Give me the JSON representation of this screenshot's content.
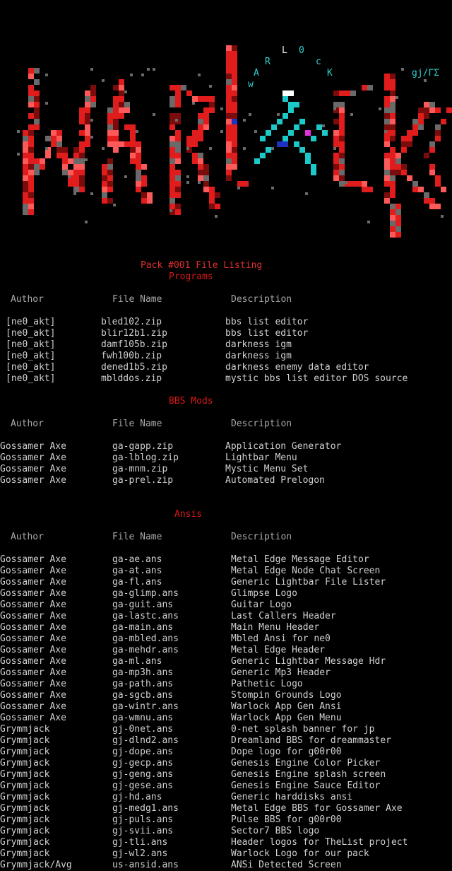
{
  "logo": {
    "letters": [
      "L",
      "0",
      "R",
      "c",
      "A",
      "K",
      "w"
    ],
    "tag": "gj/ΓΣ",
    "colors": {
      "red": "#e01c1c",
      "pink": "#ff5a5a",
      "dark": "#7a0c0c",
      "gray": "#6a6a6a",
      "cyan": "#1cc8c8",
      "blue": "#2030c0",
      "magenta": "#e030e0"
    }
  },
  "title": "Pack #001 File Listing",
  "columns": {
    "author": "Author",
    "file": "File Name",
    "desc": "Description"
  },
  "sections": [
    {
      "name": "Programs",
      "rows": [
        [
          "[ne0_akt]",
          "bled102.zip",
          "bbs list editor"
        ],
        [
          "[ne0_akt]",
          "blir12b1.zip",
          "bbs list editor"
        ],
        [
          "[ne0_akt]",
          "damf105b.zip",
          "darkness igm"
        ],
        [
          "[ne0_akt]",
          "fwh100b.zip",
          "darkness igm"
        ],
        [
          "[ne0_akt]",
          "dened1b5.zip",
          "darkness enemy data editor"
        ],
        [
          "[ne0_akt]",
          "mblddos.zip",
          "mystic bbs list editor DOS source"
        ]
      ]
    },
    {
      "name": "BBS Mods",
      "rows": [
        [
          "Gossamer Axe",
          "ga-gapp.zip",
          "Application Generator"
        ],
        [
          "Gossamer Axe",
          "ga-lblog.zip",
          "Lightbar Menu"
        ],
        [
          "Gossamer Axe",
          "ga-mnm.zip",
          "Mystic Menu Set"
        ],
        [
          "Gossamer Axe",
          "ga-prel.zip",
          "Automated Prelogon"
        ]
      ]
    },
    {
      "name": "Ansis",
      "rows": [
        [
          "Gossamer Axe",
          "ga-ae.ans",
          "Metal Edge Message Editor"
        ],
        [
          "Gossamer Axe",
          "ga-at.ans",
          "Metal Edge Node Chat Screen"
        ],
        [
          "Gossamer Axe",
          "ga-fl.ans",
          "Generic Lightbar File Lister"
        ],
        [
          "Gossamer Axe",
          "ga-glimp.ans",
          "Glimpse Logo"
        ],
        [
          "Gossamer Axe",
          "ga-guit.ans",
          "Guitar Logo"
        ],
        [
          "Gossamer Axe",
          "ga-lastc.ans",
          "Last Callers Header"
        ],
        [
          "Gossamer Axe",
          "ga-main.ans",
          "Main Menu Header"
        ],
        [
          "Gossamer Axe",
          "ga-mbled.ans",
          "Mbled Ansi for ne0"
        ],
        [
          "Gossamer Axe",
          "ga-mehdr.ans",
          "Metal Edge Header"
        ],
        [
          "Gossamer Axe",
          "ga-ml.ans",
          "Generic Lightbar Message Hdr"
        ],
        [
          "Gossamer Axe",
          "ga-mp3h.ans",
          "Generic Mp3 Header"
        ],
        [
          "Gossamer Axe",
          "ga-path.ans",
          "Pathetic Logo"
        ],
        [
          "Gossamer Axe",
          "ga-sgcb.ans",
          "Stompin Grounds Logo"
        ],
        [
          "Gossamer Axe",
          "ga-wintr.ans",
          "Warlock App Gen Ansi"
        ],
        [
          "Gossamer Axe",
          "ga-wmnu.ans",
          "Warlock App Gen Menu"
        ],
        [
          "Grymmjack",
          "gj-0net.ans",
          "0-net splash banner for jp"
        ],
        [
          "Grymmjack",
          "gj-dlnd2.ans",
          "Dreamland BBS for dreammaster"
        ],
        [
          "Grymmjack",
          "gj-dope.ans",
          "Dope logo for g00r00"
        ],
        [
          "Grymmjack",
          "gj-gecp.ans",
          "Genesis Engine Color Picker"
        ],
        [
          "Grymmjack",
          "gj-geng.ans",
          "Genesis Engine splash screen"
        ],
        [
          "Grymmjack",
          "gj-gese.ans",
          "Genesis Engine Sauce Editor"
        ],
        [
          "Grymmjack",
          "gj-hd.ans",
          "Generic harddisks ansi"
        ],
        [
          "Grymmjack",
          "gj-medg1.ans",
          "Metal Edge BBS for Gossamer Axe"
        ],
        [
          "Grymmjack",
          "gj-puls.ans",
          "Pulse BBS for g00r00"
        ],
        [
          "Grymmjack",
          "gj-svii.ans",
          "Sector7 BBS logo"
        ],
        [
          "Grymmjack",
          "gj-tli.ans",
          "Header logos for TheList project"
        ],
        [
          "Grymmjack",
          "gj-wl2.ans",
          "Warlock Logo for our pack"
        ],
        [
          "Grymmjack/Avg",
          "us-ansid.ans",
          "ANSi Detected Screen"
        ]
      ]
    }
  ]
}
